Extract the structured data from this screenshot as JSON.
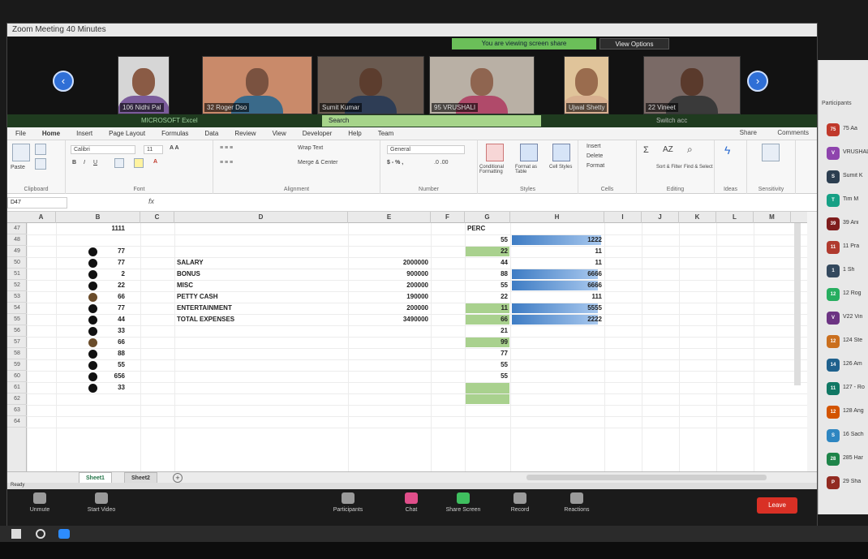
{
  "window": {
    "title": "Zoom Meeting 40 Minutes"
  },
  "gallery": {
    "banner": "You are viewing screen share",
    "view_options": "View Options",
    "participants": [
      {
        "name": "106 Nidhi Pal",
        "skin": "#8a5b45",
        "bg": "#d6d6d6",
        "shirt": "#7b5c9b"
      },
      {
        "name": "32 Roger Dso",
        "skin": "#7a5240",
        "bg": "#c98a6a",
        "shirt": "#3a6a8a"
      },
      {
        "name": "Sumit Kumar",
        "skin": "#5c3d2e",
        "bg": "#6a5a50",
        "shirt": "#2e3d55"
      },
      {
        "name": "95 VRUSHALI",
        "skin": "#8f6550",
        "bg": "#b9b0a5",
        "shirt": "#b04a6a"
      },
      {
        "name": "Ujwal Shetty",
        "skin": "#9a6c4e",
        "bg": "#e0c49a",
        "shirt": "#d8b090"
      },
      {
        "name": "22 Vineet",
        "skin": "#5a3a2c",
        "bg": "#7a6a66",
        "shirt": "#3a3a3a"
      }
    ],
    "share_label": "MICROSOFT Excel",
    "search_placeholder": "Search",
    "switch_account": "Switch acc"
  },
  "excel": {
    "menu": [
      "File",
      "Home",
      "Insert",
      "Page Layout",
      "Formulas",
      "Data",
      "Review",
      "View",
      "Developer",
      "Help",
      "Team"
    ],
    "active_menu": "Home",
    "share": "Share",
    "comments": "Comments",
    "ribbon": {
      "paste": "Paste",
      "clipboard": "Clipboard",
      "font_name": "Calibri",
      "font_size": "11",
      "font": "Font",
      "wrap_text": "Wrap Text",
      "merge_center": "Merge & Center",
      "alignment": "Alignment",
      "number_format": "General",
      "number": "Number",
      "conditional_formatting": "Conditional Formatting",
      "format_as_table": "Format as Table",
      "cell_styles": "Cell Styles",
      "styles": "Styles",
      "insert": "Insert",
      "delete": "Delete",
      "format": "Format",
      "cells": "Cells",
      "sort_filter": "Sort & Filter",
      "find_select": "Find & Select",
      "editing": "Editing",
      "ideas": "Ideas",
      "sensitivity": "Sensitivity"
    },
    "name_box": "D47",
    "fx": "fx",
    "columns": [
      "A",
      "B",
      "C",
      "D",
      "E",
      "F",
      "G",
      "H",
      "I",
      "J",
      "K",
      "L",
      "M"
    ],
    "row_numbers": [
      "47",
      "48",
      "49",
      "50",
      "51",
      "52",
      "53",
      "54",
      "55",
      "56",
      "57",
      "58",
      "59",
      "60",
      "61",
      "62",
      "63",
      "64"
    ],
    "col_b": [
      "1111",
      "",
      "77",
      "77",
      "2",
      "22",
      "66",
      "77",
      "44",
      "33",
      "66",
      "88",
      "55",
      "656",
      "33"
    ],
    "dot_rows": [
      2,
      3,
      4,
      5,
      6,
      7,
      8,
      9,
      10,
      11,
      12,
      13,
      14
    ],
    "brown_dot_rows": [
      6,
      10
    ],
    "labels": [
      "SALARY",
      "BONUS",
      "MISC",
      "PETTY CASH",
      "ENTERTAINMENT",
      "TOTAL EXPENSES"
    ],
    "amounts": [
      "2000000",
      "900000",
      "200000",
      "190000",
      "200000",
      "3490000"
    ],
    "col_g_header": "PERC",
    "col_g": [
      "55",
      "22",
      "44",
      "88",
      "55",
      "22",
      "11",
      "66",
      "21",
      "99",
      "77",
      "55",
      "55"
    ],
    "col_g_highlight_rows": [
      2,
      7,
      8,
      10
    ],
    "col_h": [
      "1222",
      "11",
      "11",
      "6666",
      "6666",
      "111",
      "5555",
      "2222"
    ],
    "col_h_bars": [
      0.98,
      0,
      0,
      0.95,
      0.95,
      0,
      0.95,
      0.95
    ],
    "sheets": [
      "Sheet1",
      "Sheet2"
    ],
    "status": "Ready"
  },
  "controls": {
    "items": [
      "Unmute",
      "Start Video",
      "Participants",
      "Chat",
      "Share Screen",
      "Record",
      "Reactions"
    ],
    "end": "Leave"
  },
  "panel": {
    "header": "Participants",
    "people": [
      {
        "initial": "75",
        "name": "75 Aa",
        "color": "#c0392b"
      },
      {
        "initial": "V",
        "name": "VRUSHALI",
        "color": "#8e44ad"
      },
      {
        "initial": "S",
        "name": "Sumit K",
        "color": "#2c3e50"
      },
      {
        "initial": "T",
        "name": "Tim M",
        "color": "#16a085"
      },
      {
        "initial": "39",
        "name": "39 Ani",
        "color": "#7f1d1d"
      },
      {
        "initial": "11",
        "name": "11 Pra",
        "color": "#b03a2e"
      },
      {
        "initial": "1",
        "name": "1 Sh",
        "color": "#34495e"
      },
      {
        "initial": "12",
        "name": "12 Rog",
        "color": "#27ae60"
      },
      {
        "initial": "V",
        "name": "V22 Vin",
        "color": "#6c3483"
      },
      {
        "initial": "12",
        "name": "124 Ste",
        "color": "#ca6f1e"
      },
      {
        "initial": "14",
        "name": "126 Am",
        "color": "#1f618d"
      },
      {
        "initial": "11",
        "name": "127 - Ro",
        "color": "#117864"
      },
      {
        "initial": "12",
        "name": "128 Ang",
        "color": "#d35400"
      },
      {
        "initial": "S",
        "name": "16 Sach",
        "color": "#2e86c1"
      },
      {
        "initial": "28",
        "name": "285 Har",
        "color": "#1e8449"
      },
      {
        "initial": "P",
        "name": "29 Sha",
        "color": "#922b21"
      }
    ]
  }
}
